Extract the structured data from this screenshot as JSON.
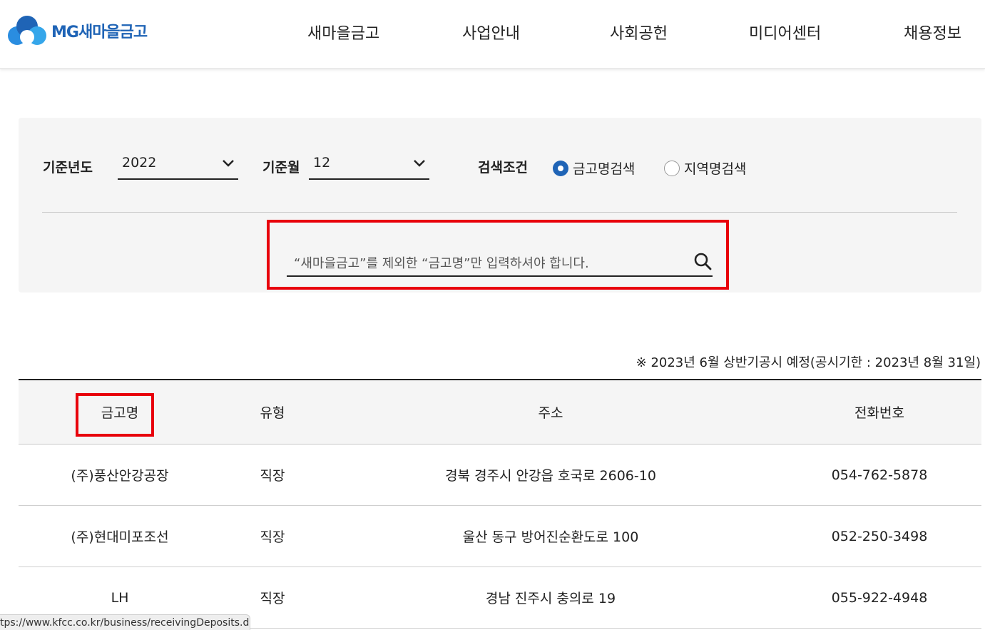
{
  "header": {
    "logo_text": "MG새마을금고",
    "nav": [
      "새마을금고",
      "사업안내",
      "사회공헌",
      "미디어센터",
      "채용정보"
    ]
  },
  "search": {
    "year_label": "기준년도",
    "year_value": "2022",
    "month_label": "기준월",
    "month_value": "12",
    "condition_label": "검색조건",
    "radio_name": "금고명검색",
    "radio_region": "지역명검색",
    "placeholder": "“새마을금고”를 제외한 “금고명”만 입력하셔야 합니다."
  },
  "notice": "※ 2023년 6월 상반기공시 예정(공시기한 : 2023년 8월 31일)",
  "table": {
    "headers": [
      "금고명",
      "유형",
      "주소",
      "전화번호"
    ],
    "rows": [
      [
        "(주)풍산안강공장",
        "직장",
        "경북 경주시 안강읍 호국로 2606-10",
        "054-762-5878"
      ],
      [
        "(주)현대미포조선",
        "직장",
        "울산 동구 방어진순환도로 100",
        "052-250-3498"
      ],
      [
        "LH",
        "직장",
        "경남 진주시 충의로 19",
        "055-922-4948"
      ]
    ]
  },
  "status_url": "tps://www.kfcc.co.kr/business/receivingDeposits.do",
  "colors": {
    "brand": "#1f64b6",
    "highlight": "#e8000b"
  }
}
